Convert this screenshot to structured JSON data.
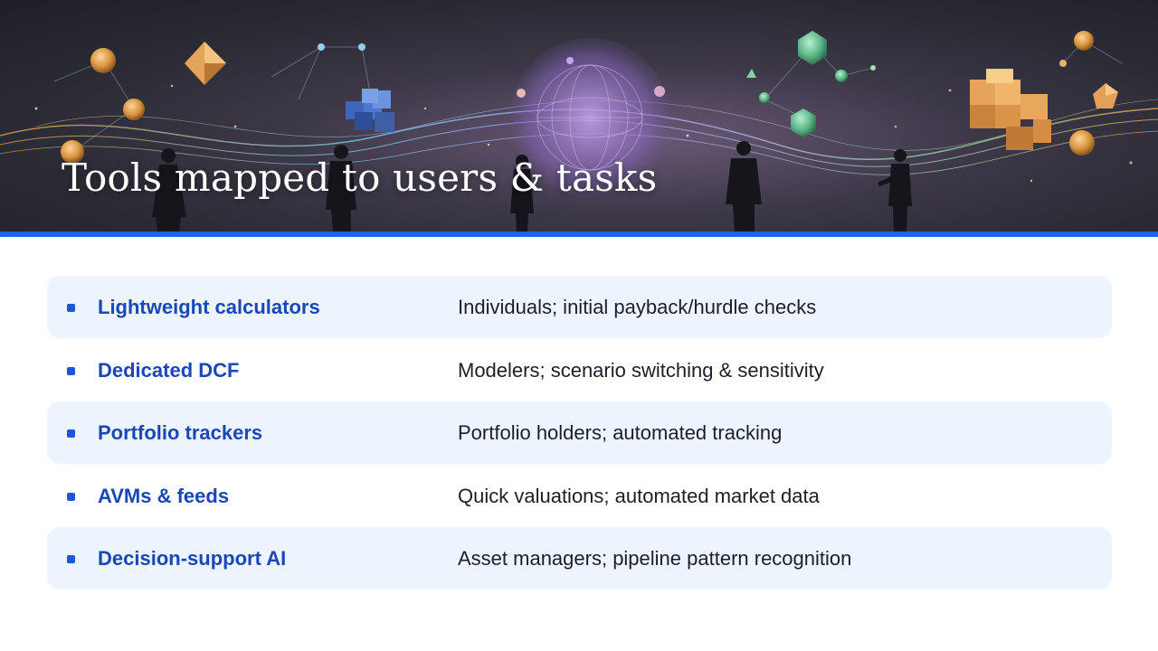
{
  "slide": {
    "title": "Tools mapped to users & tasks"
  },
  "colors": {
    "accent": "#1d64e8",
    "row_shade": "#eef4fd",
    "tool_text": "#1848b8",
    "bullet": "#1d56d9"
  },
  "rows": [
    {
      "tool": "Lightweight calculators",
      "desc": "Individuals; initial payback/hurdle checks",
      "shaded": true
    },
    {
      "tool": "Dedicated DCF",
      "desc": "Modelers; scenario switching & sensitivity",
      "shaded": false
    },
    {
      "tool": "Portfolio trackers",
      "desc": "Portfolio holders; automated tracking",
      "shaded": true
    },
    {
      "tool": "AVMs & feeds",
      "desc": "Quick valuations; automated market data",
      "shaded": false
    },
    {
      "tool": "Decision-support AI",
      "desc": "Asset managers; pipeline pattern recognition",
      "shaded": true
    }
  ]
}
